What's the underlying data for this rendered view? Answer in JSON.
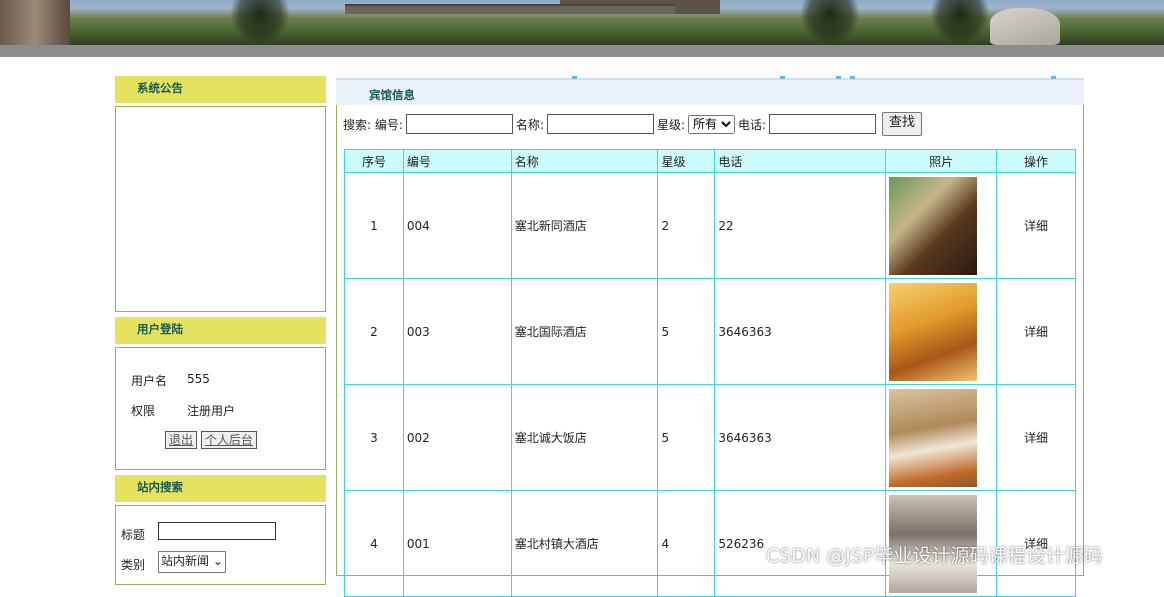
{
  "left": {
    "notice_title": "系统公告",
    "notice_marquee": "",
    "login_title": "用户登陆",
    "login": {
      "username_label": "用户名",
      "username_value": "555",
      "role_label": "权限",
      "role_value": "注册用户",
      "logout_button": "退出",
      "backend_button": "个人后台"
    },
    "search_title": "站内搜索",
    "search": {
      "title_label": "标题",
      "type_label": "类别",
      "type_selected": "站内新闻"
    }
  },
  "main": {
    "title": "宾馆信息",
    "searchbar": {
      "prefix": "搜索: 编号:",
      "name_label": "名称:",
      "star_label": "星级:",
      "star_selected": "所有",
      "phone_label": "电话:",
      "find_button": "查找"
    },
    "columns": [
      "序号",
      "编号",
      "名称",
      "星级",
      "电话",
      "照片",
      "操作"
    ],
    "rows": [
      {
        "seq": "1",
        "code": "004",
        "name": "塞北新同酒店",
        "star": "2",
        "phone": "22",
        "action": "详细"
      },
      {
        "seq": "2",
        "code": "003",
        "name": "塞北国际酒店",
        "star": "5",
        "phone": "3646363",
        "action": "详细"
      },
      {
        "seq": "3",
        "code": "002",
        "name": "塞北诚大饭店",
        "star": "5",
        "phone": "3646363",
        "action": "详细"
      },
      {
        "seq": "4",
        "code": "001",
        "name": "塞北村镇大酒店",
        "star": "4",
        "phone": "526236",
        "action": "详细"
      }
    ]
  },
  "watermark": "CSDN @JSP毕业设计源码课程设计源码",
  "colors": {
    "side_header_bg": "#e5e25f",
    "header_text": "#1d5a54",
    "table_border": "#3ad6e6",
    "table_header_bg": "#cdfcfc",
    "box_border": "#8fb55b"
  }
}
